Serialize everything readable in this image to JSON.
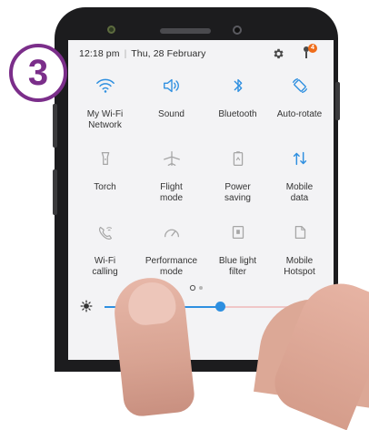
{
  "step_badge": "3",
  "status": {
    "time": "12:18 pm",
    "separator": "|",
    "date": "Thu, 28 February",
    "notification_count": "4"
  },
  "tiles": [
    {
      "label_line1": "My Wi-Fi",
      "label_line2": "Network",
      "icon": "wifi-icon",
      "active": true
    },
    {
      "label_line1": "Sound",
      "label_line2": "",
      "icon": "speaker-icon",
      "active": true
    },
    {
      "label_line1": "Bluetooth",
      "label_line2": "",
      "icon": "bluetooth-icon",
      "active": true
    },
    {
      "label_line1": "Auto-rotate",
      "label_line2": "",
      "icon": "auto-rotate-icon",
      "active": true
    },
    {
      "label_line1": "Torch",
      "label_line2": "",
      "icon": "torch-icon",
      "active": false
    },
    {
      "label_line1": "Flight",
      "label_line2": "mode",
      "icon": "airplane-icon",
      "active": false
    },
    {
      "label_line1": "Power",
      "label_line2": "saving",
      "icon": "battery-icon",
      "active": false
    },
    {
      "label_line1": "Mobile",
      "label_line2": "data",
      "icon": "mobile-data-icon",
      "active": true
    },
    {
      "label_line1": "Wi-Fi",
      "label_line2": "calling",
      "icon": "wifi-calling-icon",
      "active": false
    },
    {
      "label_line1": "Performance",
      "label_line2": "mode",
      "icon": "gauge-icon",
      "active": false
    },
    {
      "label_line1": "Blue light",
      "label_line2": "filter",
      "icon": "blue-light-filter-icon",
      "active": false
    },
    {
      "label_line1": "Mobile",
      "label_line2": "Hotspot",
      "icon": "hotspot-icon",
      "active": false
    }
  ],
  "brightness": {
    "level": 0.55,
    "icon": "brightness-icon"
  },
  "page_indicator": {
    "pages": 2,
    "current": 1
  },
  "colors": {
    "accent": "#2e8fe0",
    "inactive_icon": "#a6a6a6",
    "step_badge": "#7b2e8a",
    "notification_badge": "#ef6c1a"
  }
}
